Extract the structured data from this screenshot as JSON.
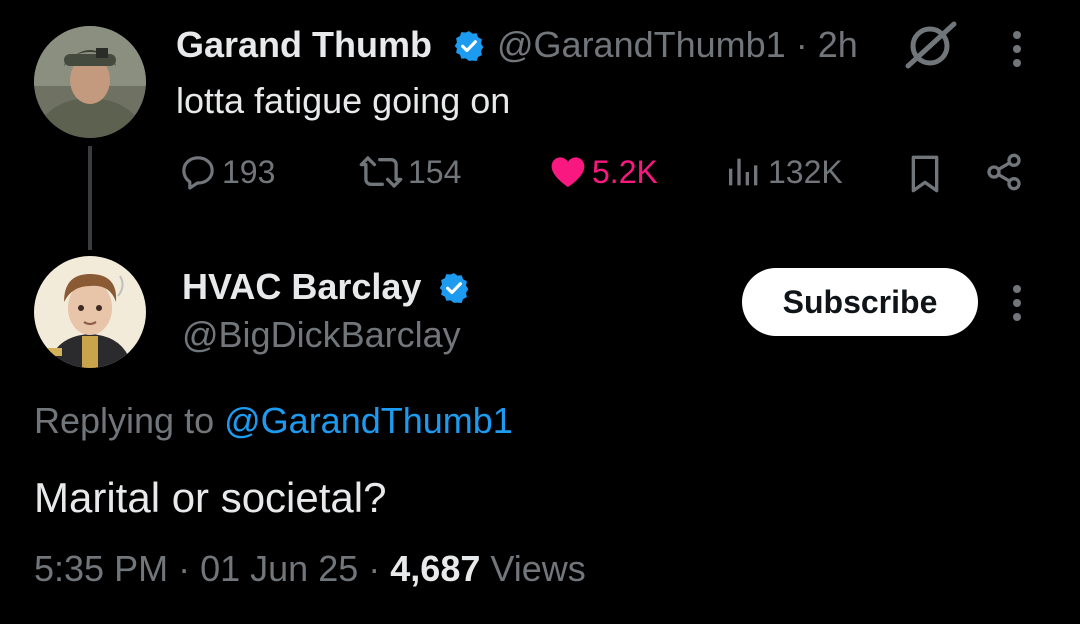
{
  "parent_tweet": {
    "author_name": "Garand Thumb",
    "handle": "@GarandThumb1",
    "separator": "·",
    "time": "2h",
    "text": "lotta fatigue going on",
    "reply_count": "193",
    "retweet_count": "154",
    "like_count": "5.2K",
    "view_count": "132K",
    "like_color": "#f91880"
  },
  "reply_tweet": {
    "author_name": "HVAC Barclay",
    "handle": "@BigDickBarclay",
    "subscribe_label": "Subscribe",
    "replying_prefix": "Replying to",
    "replying_mention": "@GarandThumb1",
    "text": "Marital or societal?",
    "time": "5:35 PM",
    "separator": "·",
    "date": "01 Jun 25",
    "views_count": "4,687",
    "views_label": "Views"
  },
  "colors": {
    "background": "#000000",
    "primary_text": "#e7e9ea",
    "secondary_text": "#71767b",
    "accent": "#1d9bf0"
  },
  "icons": [
    "verified-badge-icon",
    "grok-icon",
    "more-icon",
    "reply-icon",
    "retweet-icon",
    "like-icon",
    "views-icon",
    "bookmark-icon",
    "share-icon"
  ]
}
